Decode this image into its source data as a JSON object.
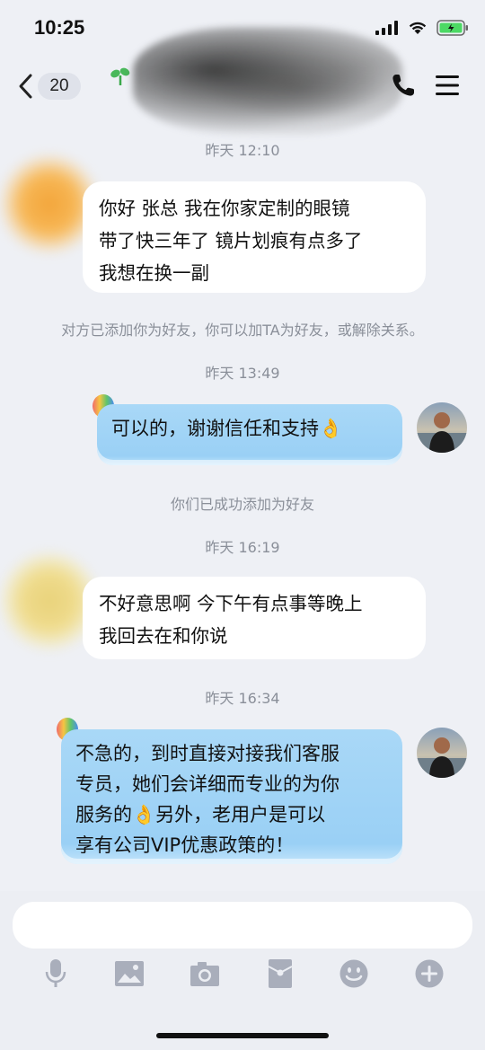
{
  "status_bar": {
    "time": "10:25"
  },
  "header": {
    "back_count": "20",
    "icons": [
      "back-chevron-icon",
      "sprout-icon",
      "phone-icon",
      "menu-icon"
    ]
  },
  "messages": [
    {
      "type": "timestamp",
      "text": "昨天 12:10"
    },
    {
      "type": "incoming",
      "lines": [
        "你好 张总 我在你家定制的眼镜",
        "带了快三年了 镜片划痕有点多了",
        "我想在换一副"
      ]
    },
    {
      "type": "system",
      "text": "对方已添加你为好友，你可以加TA为好友，或解除关系。"
    },
    {
      "type": "timestamp",
      "text": "昨天 13:49"
    },
    {
      "type": "outgoing",
      "lines": [
        "可以的，谢谢信任和支持👌"
      ]
    },
    {
      "type": "system",
      "text": "你们已成功添加为好友"
    },
    {
      "type": "timestamp",
      "text": "昨天 16:19"
    },
    {
      "type": "incoming",
      "lines": [
        "不好意思啊 今下午有点事等晚上",
        "我回去在和你说"
      ]
    },
    {
      "type": "timestamp",
      "text": "昨天 16:34"
    },
    {
      "type": "outgoing",
      "lines": [
        "不急的，到时直接对接我们客服",
        "专员，她们会详细而专业的为你",
        "服务的👌另外，老用户是可以",
        "享有公司VIP优惠政策的！"
      ]
    }
  ],
  "input": {
    "value": "",
    "placeholder": ""
  },
  "toolbar": {
    "icons": [
      "microphone-icon",
      "image-icon",
      "camera-icon",
      "red-packet-icon",
      "emoji-icon",
      "plus-icon"
    ]
  },
  "colors": {
    "background": "#eef0f5",
    "outgoing_bubble": "#a9d8f7",
    "incoming_bubble": "#ffffff",
    "meta_text": "#8a8f99"
  }
}
